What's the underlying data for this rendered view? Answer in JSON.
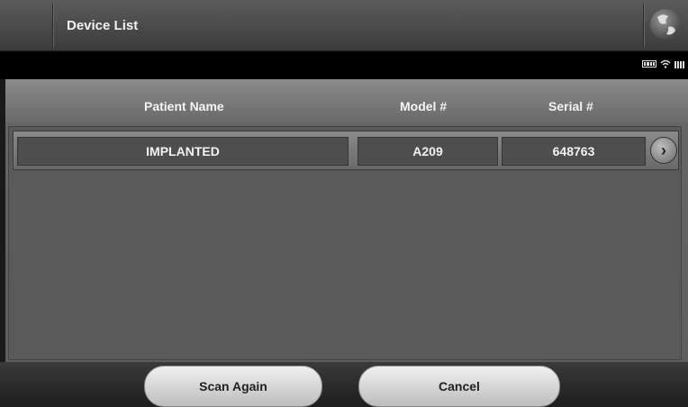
{
  "window": {
    "title": "Device List",
    "logo": "globe-icon"
  },
  "status": {
    "icons": [
      "battery-icon",
      "wifi-icon",
      "signal-icon"
    ]
  },
  "table": {
    "columns": [
      "Patient Name",
      "Model #",
      "Serial #"
    ],
    "rows": [
      {
        "patient_name": "IMPLANTED",
        "model": "A209",
        "serial": "648763",
        "action_icon": "chevron-right-icon"
      }
    ]
  },
  "footer": {
    "scan_again_label": "Scan Again",
    "cancel_label": "Cancel"
  }
}
